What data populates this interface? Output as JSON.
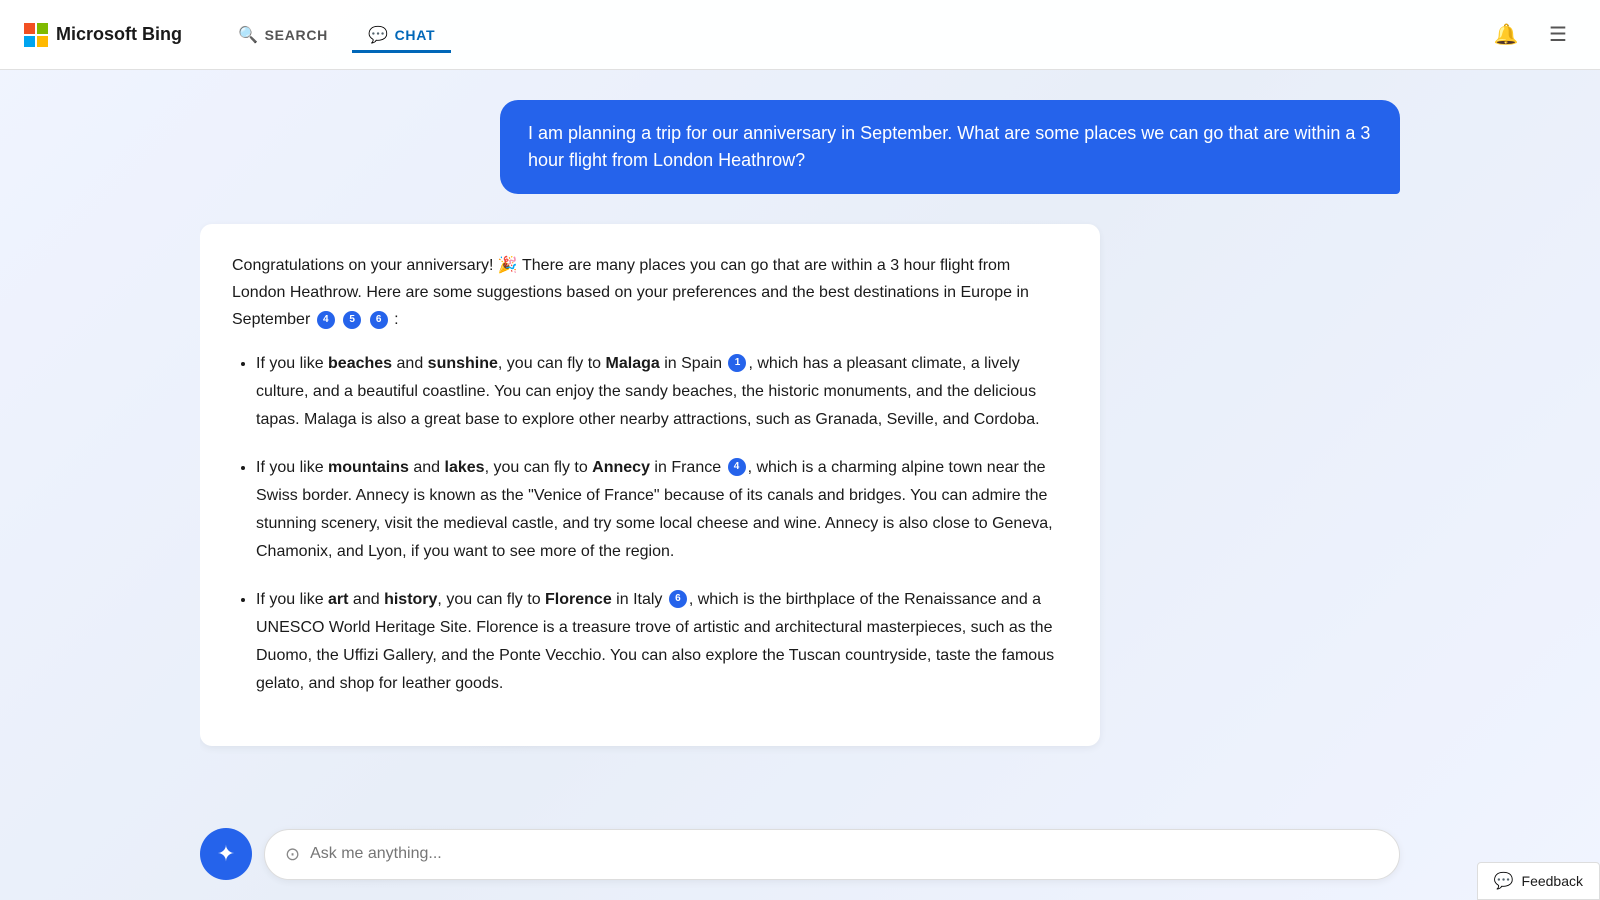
{
  "header": {
    "logo_text": "Microsoft Bing",
    "nav": {
      "search_label": "SEARCH",
      "chat_label": "CHAT"
    }
  },
  "user_message": {
    "text": "I am planning a trip for our anniversary in September. What are some places we can go that are within a 3 hour flight from London Heathrow?"
  },
  "ai_response": {
    "intro": "Congratulations on your anniversary! 🎉 There are many places you can go that are within a 3 hour flight from London Heathrow. Here are some suggestions based on your preferences and the best destinations in Europe in September",
    "items": [
      {
        "text_start": "If you like ",
        "bold1": "beaches",
        "text_mid1": " and ",
        "bold2": "sunshine",
        "text_mid2": ", you can fly to ",
        "bold3": "Malaga",
        "text_mid3": " in Spain",
        "citation": "1",
        "text_end": ", which has a pleasant climate, a lively culture, and a beautiful coastline. You can enjoy the sandy beaches, the historic monuments, and the delicious tapas. Malaga is also a great base to explore other nearby attractions, such as Granada, Seville, and Cordoba."
      },
      {
        "text_start": "If you like ",
        "bold1": "mountains",
        "text_mid1": " and ",
        "bold2": "lakes",
        "text_mid2": ", you can fly to ",
        "bold3": "Annecy",
        "text_mid3": " in France",
        "citation": "4",
        "text_end": ", which is a charming alpine town near the Swiss border. Annecy is known as the \"Venice of France\" because of its canals and bridges. You can admire the stunning scenery, visit the medieval castle, and try some local cheese and wine. Annecy is also close to Geneva, Chamonix, and Lyon, if you want to see more of the region."
      },
      {
        "text_start": "If you like ",
        "bold1": "art",
        "text_mid1": " and ",
        "bold2": "history",
        "text_mid2": ", you can fly to ",
        "bold3": "Florence",
        "text_mid3": " in Italy",
        "citation": "6",
        "text_end": ", which is the birthplace of the Renaissance and a UNESCO World Heritage Site. Florence is a treasure trove of artistic and architectural masterpieces, such as the Duomo, the Uffizi Gallery, and the Ponte Vecchio. You can also explore the Tuscan countryside, taste the famous gelato, and shop for leather goods."
      }
    ]
  },
  "input": {
    "placeholder": "Ask me anything..."
  },
  "feedback": {
    "label": "Feedback"
  }
}
